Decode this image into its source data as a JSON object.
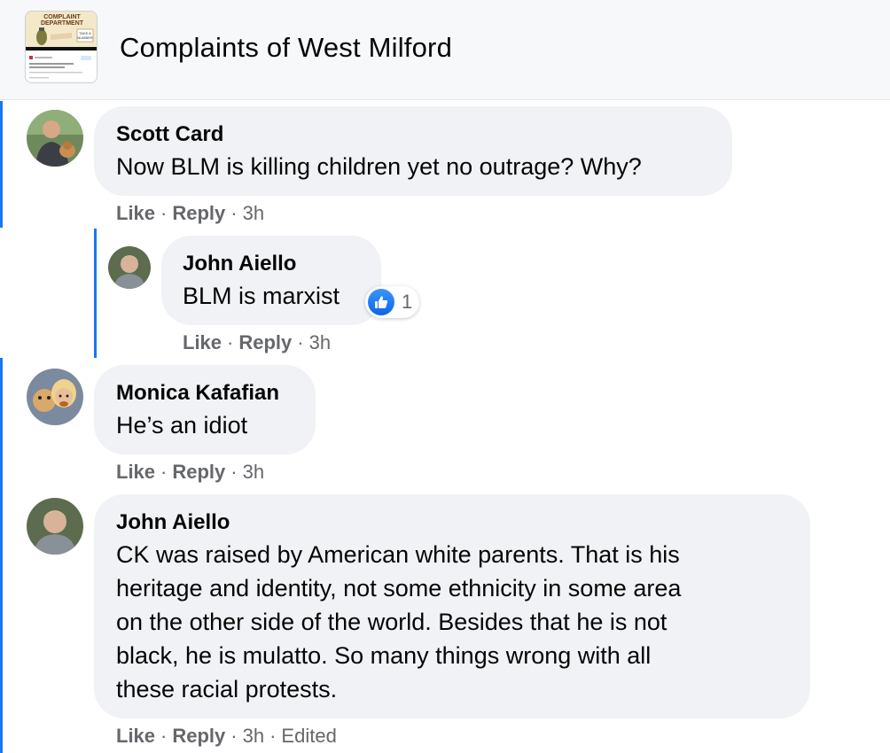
{
  "header": {
    "group_name": "Complaints of West Milford",
    "thumbnail": {
      "top_text": "COMPLAINT",
      "sub_text": "DEPARTMENT",
      "tag_text": "TAKE A NUMBER"
    }
  },
  "comments": [
    {
      "author": "Scott Card",
      "text": "Now BLM is killing children yet no outrage? Why?",
      "like_label": "Like",
      "reply_label": "Reply",
      "time": "3h"
    },
    {
      "author": "John Aiello",
      "text": "BLM is marxist",
      "like_label": "Like",
      "reply_label": "Reply",
      "time": "3h",
      "reaction": {
        "icon": "thumbs-up-icon",
        "count": "1"
      }
    },
    {
      "author": "Monica Kafafian",
      "text": "He’s an idiot",
      "like_label": "Like",
      "reply_label": "Reply",
      "time": "3h"
    },
    {
      "author": "John Aiello",
      "text_lines": [
        "CK was raised by American white parents. That is his",
        "heritage and identity, not some ethnicity in some area",
        "on the other side of the world. Besides that he is not",
        "black, he is mulatto. So many things wrong with all",
        "these racial protests."
      ],
      "like_label": "Like",
      "reply_label": "Reply",
      "time": "3h",
      "edited_label": "Edited"
    }
  ],
  "colors": {
    "thread_line": "#1877f2",
    "bubble": "#f0f2f5",
    "meta_text": "#65676b",
    "header_bg": "#f7f8fa"
  }
}
